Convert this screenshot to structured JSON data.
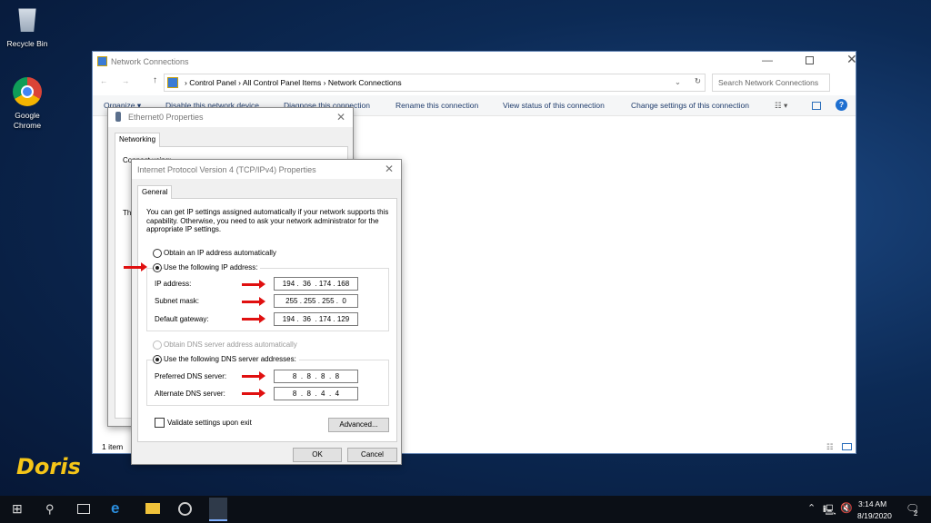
{
  "desktop": {
    "icons": [
      {
        "label": "Recycle Bin",
        "icon": "recycle-bin-icon"
      },
      {
        "label": "Google Chrome",
        "icon": "chrome-icon"
      }
    ],
    "logo": "Doris"
  },
  "explorer": {
    "title": "Network Connections",
    "breadcrumb": [
      "Control Panel",
      "All Control Panel Items",
      "Network Connections"
    ],
    "search_placeholder": "Search Network Connections",
    "toolbar": [
      "Organize ▾",
      "Disable this network device",
      "Diagnose this connection",
      "Rename this connection",
      "View status of this connection",
      "Change settings of this connection"
    ],
    "status": "1 item"
  },
  "eth_dialog": {
    "title": "Ethernet0 Properties",
    "tab": "Networking",
    "connect_using": "Connect using:",
    "this_conn": "Th"
  },
  "ipv4_dialog": {
    "title": "Internet Protocol Version 4 (TCP/IPv4) Properties",
    "tab": "General",
    "description": "You can get IP settings assigned automatically if your network supports this capability. Otherwise, you need to ask your network administrator for the appropriate IP settings.",
    "obtain_ip": "Obtain an IP address automatically",
    "use_ip": "Use the following IP address:",
    "ip_label": "IP address:",
    "ip_value": "194 .  36  . 174 . 168",
    "mask_label": "Subnet mask:",
    "mask_value": "255 . 255 . 255 .  0",
    "gw_label": "Default gateway:",
    "gw_value": "194 .  36  . 174 . 129",
    "obtain_dns": "Obtain DNS server address automatically",
    "use_dns": "Use the following DNS server addresses:",
    "pref_label": "Preferred DNS server:",
    "pref_value": "8  .  8  .  8  .  8",
    "alt_label": "Alternate DNS server:",
    "alt_value": "8  .  8  .  4  .  4",
    "validate": "Validate settings upon exit",
    "advanced": "Advanced...",
    "ok": "OK",
    "cancel": "Cancel",
    "selected_ip_mode": "manual",
    "selected_dns_mode": "manual",
    "validate_checked": false
  },
  "taskbar": {
    "time": "3:14 AM",
    "date": "8/19/2020",
    "notifications": "2"
  },
  "colors": {
    "arrow": "#e01010",
    "taskbar": "#0b0f16",
    "logo": "#f5c518"
  }
}
